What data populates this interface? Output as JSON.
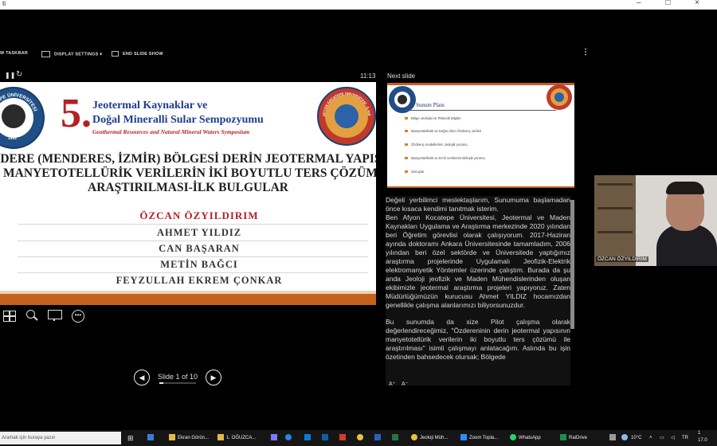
{
  "window": {
    "title": "ti",
    "controls": "– □ ×"
  },
  "toolbar": {
    "show_taskbar": "W TASKBAR",
    "display_settings": "DISPLAY SETTINGS ▾",
    "end_slide_show": "END SLIDE SHOW",
    "more": "⋮"
  },
  "presenter": {
    "timer": "11:13",
    "next_slide_label": "Next slide"
  },
  "slide": {
    "event_number": "5.",
    "event_title_line1": "Jeotermal Kaynaklar ve",
    "event_title_line2": "Doğal Mineralli Sular Sempozyumu",
    "event_title_en": "Geothermal Resources and Natural Mineral Waters Symposium",
    "left_seal_top": "KOCATEPE ÜNİVERSİTESİ",
    "left_seal_year": "1992",
    "right_seal_text": "AFYON KOCATEPE ÜNİVERSİTESİ · İLAHİYAT FAKÜLTESİ",
    "title_line1": "ZDERE (MENDERES, İZMİR) BÖLGESİ DERİN JEOTERMAL YAPISININ",
    "title_line2": "MANYETOTELLÜRİK VERİLERİN İKİ BOYUTLU TERS ÇÖZÜMÜ İLE",
    "title_line3": "ARAŞTIRILMASI-İLK BULGULAR",
    "authors": [
      "ÖZCAN ÖZYILDIRIM",
      "AHMET YILDIZ",
      "CAN BAŞARAN",
      "METİN BAĞCI",
      "FEYZULLAH EKREM ÇONKAR"
    ],
    "colors": {
      "accent": "#b52026",
      "stripe": "#c5601d",
      "title": "#1f1f1f"
    }
  },
  "slide_nav": {
    "counter": "Slide 1 of 10"
  },
  "next_slide": {
    "heading": "Sunum Planı",
    "items": [
      "Bölge Jeolojisi ve Tektonik Bilgiler",
      "Manyetotellürik ve Doğru Akım Özdirenç verileri",
      "Özdirenç modellerinin Jeolojik yorumu",
      "Manyetotellürik ve DAÖ verilerinin Birleşik yorumu",
      "Sonuçlar"
    ]
  },
  "notes": {
    "para1": "Değeli yerbilimci meslektaşlarım, Sunumuma başlamadan önce kısaca kendimi tanıtmak isterim.\nBen Afyon Kocatepe Üniversitesi, Jeotermal ve Maden Kaynakları Uygulama ve Araştırma merkezinde 2020 yılından beri Öğretim görevlisi olarak çalışıyorum. 2017-Haziran ayında doktoramı Ankara Üniversitesinde tamamladım, 2006 yılından beri özel sektörde ve Üniversitede yaptığımız araştırma projelerinde Uygulamalı Jeofizik-Elektrik elektromanyetik Yöntemler üzerinde çalıştım. Burada da şu anda Jeoloji jeofizik ve Maden Mühendislerinden oluşan ekibimizle jeotermal araştırma projeleri yapıyoruz. Zaten Müdürlüğümüzün kurucusu Ahmet YILDIZ hocamızdan genellikle çalışma alanlarımızı biliyorsunuzdur.",
    "para2": "Bu sunumda da size Pilot çalışma olarak değerlendireceğimiz, \"Özdereninin derin jeotermal yapısının manyetotellürik verilerin iki boyutlu ters çözümü ile araştırılması\" isimli çalışmayı anlatacağım. Aslında bu işin özetinden bahsedecek olursak; Bölgede",
    "font_controls": [
      "A⁺",
      "A⁻"
    ]
  },
  "video": {
    "name": "ÖZCAN ÖZYILDIRIM"
  },
  "taskbar": {
    "search_placeholder": "Aramak için buraya yazın",
    "apps": [
      "Ekran Görün...",
      "1. OĞUZCA...",
      "Jeoloji Müh...",
      "Zoom Topla...",
      "WhatsApp",
      "RaiDrive"
    ],
    "temperature": "10°C",
    "clock_time": "1",
    "clock_date": "17.0"
  }
}
